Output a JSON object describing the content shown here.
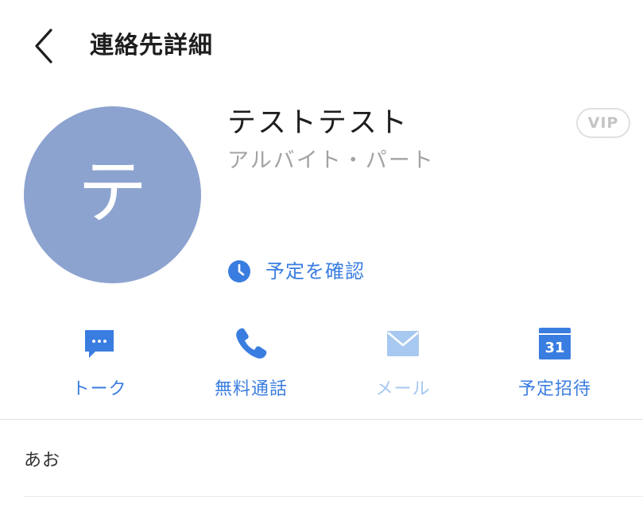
{
  "header": {
    "title": "連絡先詳細",
    "back_icon": "chevron-left-icon"
  },
  "profile": {
    "initial": "テ",
    "name": "テストテスト",
    "subtitle": "アルバイト・パート",
    "vip_label": "VIP",
    "schedule_label": "予定を確認",
    "schedule_icon": "clock-icon"
  },
  "actions": [
    {
      "label": "トーク",
      "icon": "chat-bubble-icon",
      "enabled": true
    },
    {
      "label": "無料通話",
      "icon": "phone-icon",
      "enabled": true
    },
    {
      "label": "メール",
      "icon": "mail-icon",
      "enabled": false
    },
    {
      "label": "予定招待",
      "icon": "calendar-icon",
      "enabled": true,
      "icon_text": "31"
    }
  ],
  "details": {
    "first_row": "あお"
  },
  "colors": {
    "accent": "#3a7de0",
    "accent_disabled": "#a7c8f0",
    "avatar_bg": "#8da3cf",
    "text_primary": "#1e1e1e",
    "text_secondary": "#a3a3a3"
  }
}
